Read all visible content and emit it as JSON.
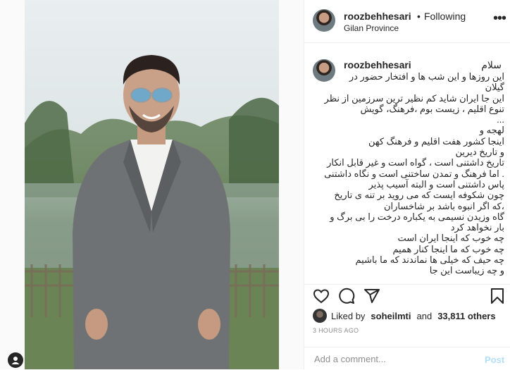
{
  "header": {
    "username": "roozbehhesari",
    "separator": "•",
    "follow_status": "Following",
    "location": "Gilan Province",
    "more_icon": "more-horizontal-icon"
  },
  "comment": {
    "username": "roozbehhesari",
    "first_line": "سلام",
    "caption_lines": [
      "این روزها و این شب ها و افتخار حضور در",
      "گیلان",
      "این جا ایران شاید کم نظیر ترین سرزمین از نظر",
      "تنوع اقلیم ، زیست بوم ،فرهنگ، گویش",
      "...",
      "لهجه و",
      "اینجا کشور هفت اقلیم و فرهنگ کهن",
      "و تاریخ دیرین",
      "تاریخ داشتنی است ، گواه است و غیر قابل انکار",
      ". اما فرهنگ و تمدن ساختنی است و نگاه داشتنی",
      "پاس داشتنی است و البته آسیب پذیر",
      "چون شکوفه ایست که می روید بر تنه ی تاریخ",
      "،که اگر انبوه باشد بر شاخساران",
      "گاه وزیدن نسیمی به یکباره درخت را بی برگ و",
      "بار نخواهد کرد",
      "چه خوب که اینجا ایران است",
      "چه خوب که ما اینجا کنار همیم",
      "چه حیف که خیلی ها نماندند که ما باشیم",
      "و چه زیباست این جا"
    ]
  },
  "actions": {
    "like_icon": "heart-icon",
    "comment_icon": "comment-icon",
    "share_icon": "share-icon",
    "save_icon": "bookmark-icon"
  },
  "likes": {
    "prefix": "Liked by",
    "user": "soheilmti",
    "connector": "and",
    "count": "33,811 others"
  },
  "timestamp": "3 HOURS AGO",
  "add_comment": {
    "placeholder": "Add a comment...",
    "post_label": "Post"
  },
  "colors": {
    "text": "#262626",
    "muted": "#8e8e8e",
    "border": "#efefef",
    "post_disabled": "#b2dffc"
  }
}
